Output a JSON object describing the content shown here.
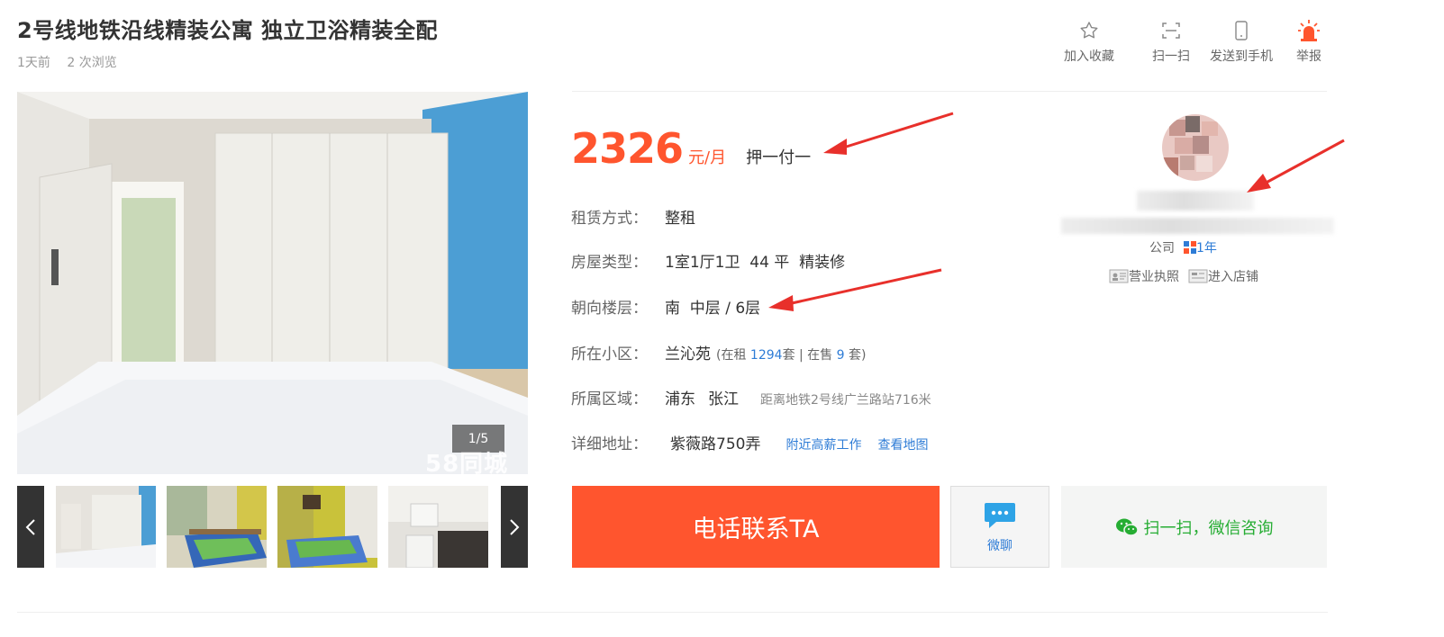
{
  "listing": {
    "title": "2号线地铁沿线精装公寓 独立卫浴精装全配",
    "posted": "1天前",
    "views": "2 次浏览"
  },
  "actions": [
    {
      "label": "加入收藏",
      "icon": "star-icon"
    },
    {
      "label": "扫一扫",
      "icon": "scan-icon"
    },
    {
      "label": "发送到手机",
      "icon": "phone-icon"
    },
    {
      "label": "举报",
      "icon": "alarm-icon"
    }
  ],
  "gallery": {
    "counter": "1/5",
    "watermark": "58同城",
    "prev_icon": "chevron-left-icon",
    "next_icon": "chevron-right-icon"
  },
  "price": {
    "amount": "2326",
    "unit": "元/月",
    "payment": "押一付一"
  },
  "details": {
    "rent_type_label": "租赁方式：",
    "rent_type": "整租",
    "house_type_label": "房屋类型：",
    "house_type": "1室1厅1卫  44 平  精装修",
    "orientation_label": "朝向楼层：",
    "orientation": "南  中层 / 6层",
    "community_label": "所在小区：",
    "community": "兰沁苑",
    "community_rent_prefix": "(在租 ",
    "community_rent_count": "1294",
    "community_rent_suffix": "套 | 在售 ",
    "community_sale_count": "9",
    "community_sale_suffix": " 套)",
    "area_label": "所属区域：",
    "district": "浦东",
    "subarea": "张江",
    "subway": "距离地铁2号线广兰路站716米",
    "address_label": "详细地址：",
    "address": "紫薇路750弄",
    "nearby_jobs": "附近高薪工作",
    "view_map": "查看地图"
  },
  "contact": {
    "call": "电话联系TA",
    "chat": "微聊",
    "wechat": "扫一扫，微信咨询"
  },
  "agent": {
    "company_label": "公司",
    "years": "1年",
    "license": "营业执照",
    "shop": "进入店铺"
  },
  "colors": {
    "accent": "#ff552e",
    "link": "#2e7cd6",
    "wechat": "#26ad33",
    "annotation_arrow": "#e8302b"
  }
}
